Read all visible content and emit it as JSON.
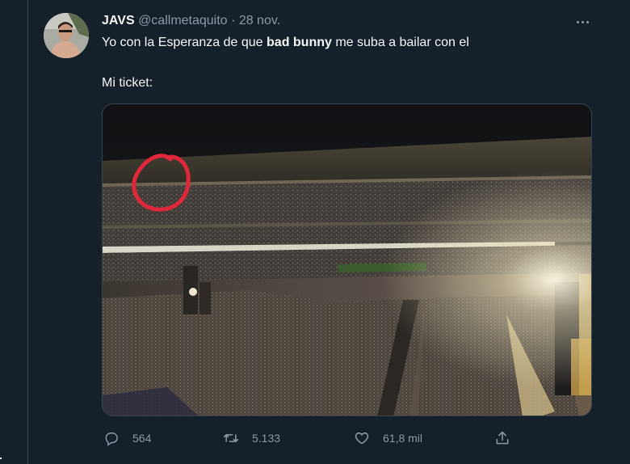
{
  "tweet": {
    "author_name": "JAVS",
    "handle": "@callmetaquito",
    "separator": "·",
    "date": "28 nov.",
    "text_before": "Yo con la Esperanza de que ",
    "text_bold": "bad bunny",
    "text_after": " me suba a bailar con el",
    "text_line2": "Mi ticket:"
  },
  "actions": {
    "replies": "564",
    "retweets": "5.133",
    "likes": "61,8 mil"
  },
  "icons": {
    "more": "more-horizontal-icon",
    "reply": "reply-icon",
    "retweet": "retweet-icon",
    "like": "heart-icon",
    "share": "share-icon"
  },
  "colors": {
    "background": "#15202b",
    "secondary_text": "#8b98a5",
    "annotation_circle": "#e0283c"
  }
}
